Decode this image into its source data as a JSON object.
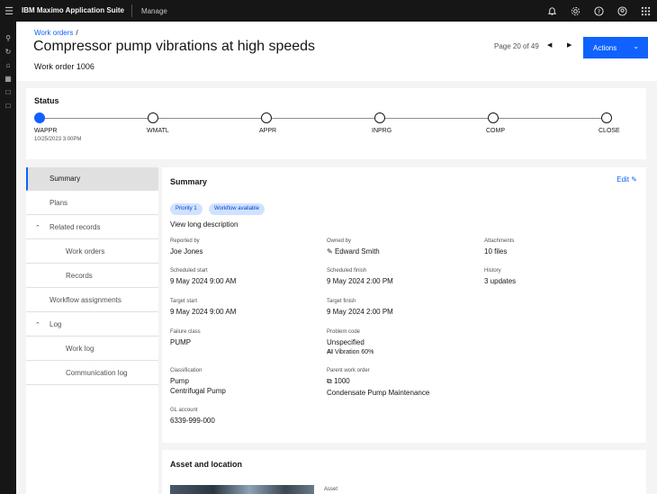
{
  "topbar": {
    "suite": "IBM Maximo Application Suite",
    "app": "Manage"
  },
  "header": {
    "breadcrumb": "Work orders",
    "breadcrumb_sep": "/",
    "title": "Compressor pump vibrations at high speeds",
    "subtitle": "Work order 1006",
    "pager": "Page 20 of 49",
    "actions_label": "Actions"
  },
  "status": {
    "label": "Status",
    "steps": [
      {
        "code": "WAPPR",
        "active": true
      },
      {
        "code": "WMATL",
        "active": false
      },
      {
        "code": "APPR",
        "active": false
      },
      {
        "code": "INPRG",
        "active": false
      },
      {
        "code": "COMP",
        "active": false
      },
      {
        "code": "CLOSE",
        "active": false
      }
    ],
    "date": "10/25/2023 3:00PM"
  },
  "nav": {
    "items": [
      {
        "label": "Summary"
      },
      {
        "label": "Plans"
      },
      {
        "label": "Related records"
      },
      {
        "label": "Work orders"
      },
      {
        "label": "Records"
      },
      {
        "label": "Workflow assignments"
      },
      {
        "label": "Log"
      },
      {
        "label": "Work log"
      },
      {
        "label": "Communication log"
      }
    ]
  },
  "summary": {
    "heading": "Summary",
    "edit_label": "Edit",
    "tags": [
      "Priority 1",
      "Workflow available"
    ],
    "view_long": "View long description",
    "fields": {
      "reported_by": {
        "label": "Reported by",
        "value": "Joe Jones"
      },
      "owned_by": {
        "label": "Owned by",
        "value": "Edward Smith"
      },
      "attachments": {
        "label": "Attachments",
        "value": "10 files"
      },
      "sched_start": {
        "label": "Scheduled start",
        "value": "9 May 2024 9:00 AM"
      },
      "sched_finish": {
        "label": "Scheduled finish",
        "value": "9 May 2024 2:00 PM"
      },
      "history": {
        "label": "History",
        "value": "3 updates"
      },
      "target_start": {
        "label": "Target start",
        "value": "9 May 2024 9:00 AM"
      },
      "target_finish": {
        "label": "Target finish",
        "value": "9 May 2024 2:00 PM"
      },
      "failure_class": {
        "label": "Failure class",
        "value": "PUMP"
      },
      "problem_code": {
        "label": "Problem code",
        "value": "Unspecified",
        "ai": "AI",
        "ai_value": "Vibration 60%"
      },
      "classification": {
        "label": "Classification",
        "value": "Pump",
        "value2": "Centrifugal Pump"
      },
      "parent_wo": {
        "label": "Parent work order",
        "value": "1000",
        "value2": "Condensate Pump Maintenance"
      },
      "gl_account": {
        "label": "GL account",
        "value": "6339-999-000"
      }
    }
  },
  "asset": {
    "heading": "Asset and location",
    "asset_label": "Asset"
  },
  "colors": {
    "accent": "#0f62fe",
    "topbar": "#161616",
    "tag_bg": "#d0e2ff"
  }
}
